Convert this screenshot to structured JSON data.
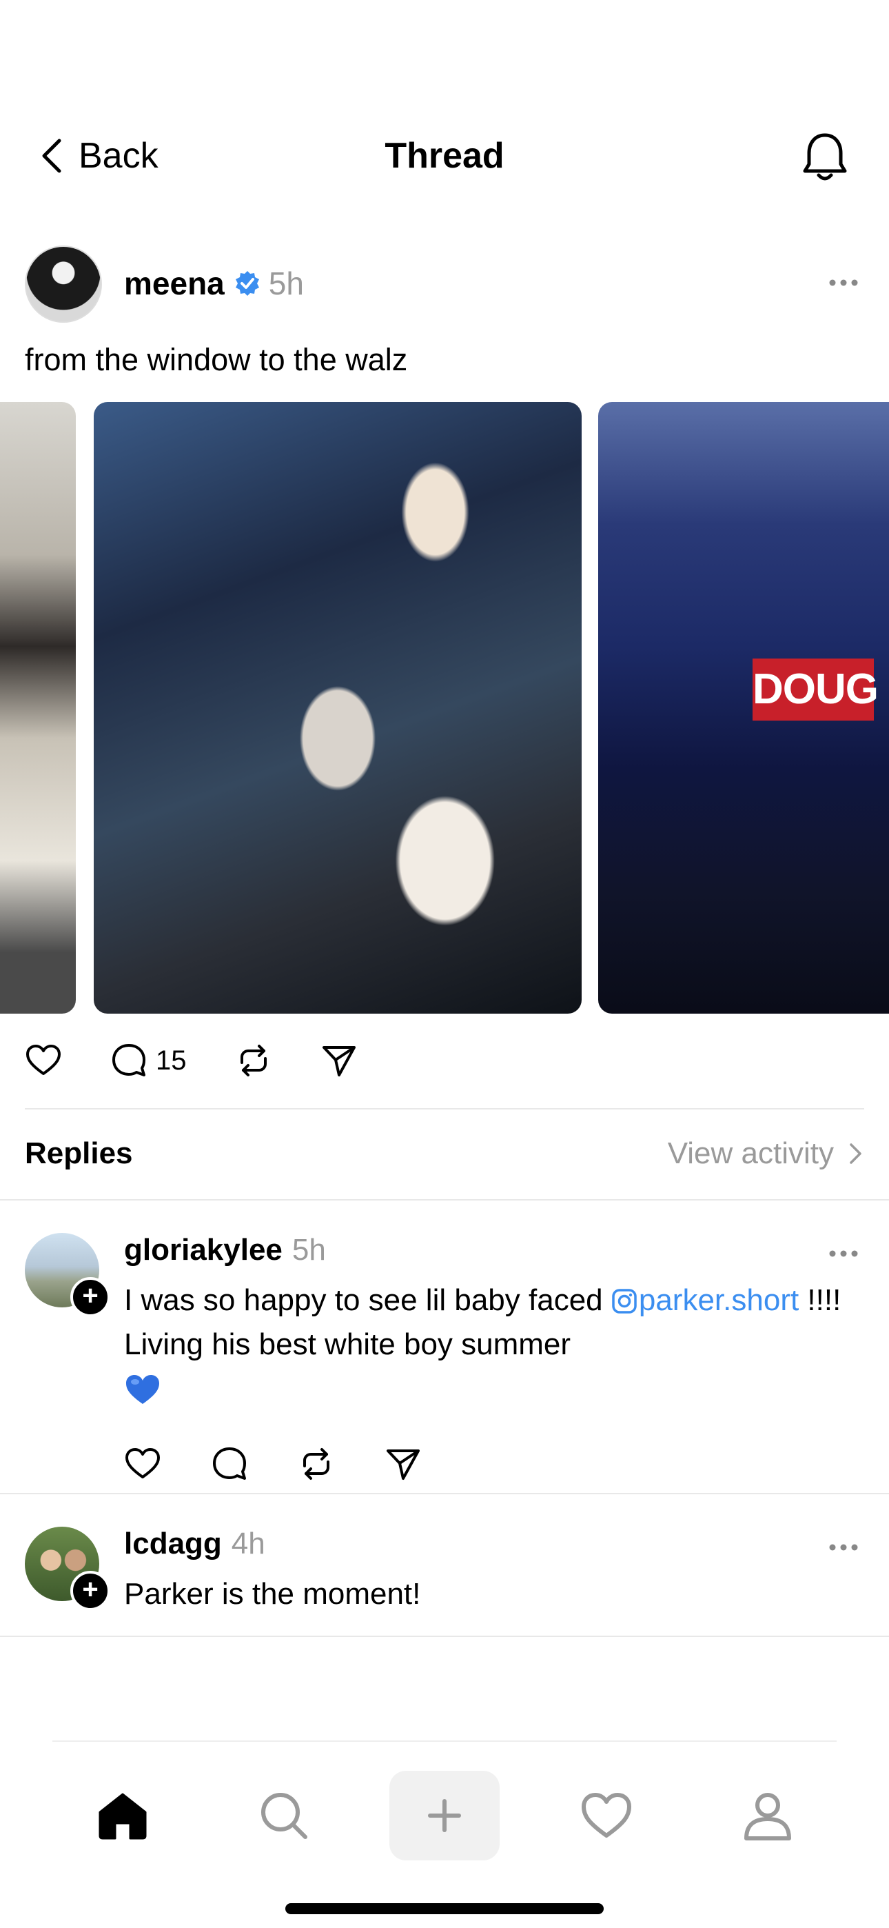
{
  "header": {
    "back_label": "Back",
    "title": "Thread"
  },
  "post": {
    "username": "meena",
    "time": "5h",
    "text": "from the window to the walz",
    "image_sign_text": "DOUG",
    "reply_count": "15"
  },
  "replies_section": {
    "label": "Replies",
    "view_activity_label": "View activity"
  },
  "replies": [
    {
      "username": "gloriakylee",
      "time": "5h",
      "text_before": "I was so happy to see lil baby faced ",
      "mention": "parker.short",
      "text_after": " !!!! Living his best white boy summer"
    },
    {
      "username": "lcdagg",
      "time": "4h",
      "text": "Parker is the moment!"
    }
  ],
  "colors": {
    "verified": "#3b8ef0",
    "mention": "#3b8ef0",
    "muted": "#9a9a9a",
    "heart_emoji": "#2f6fe0"
  },
  "icons": {
    "tabbar": [
      "home-icon",
      "search-icon",
      "create-icon",
      "activity-heart-icon",
      "profile-icon"
    ],
    "post_actions": [
      "like-icon",
      "comment-icon",
      "repost-icon",
      "share-icon"
    ]
  }
}
